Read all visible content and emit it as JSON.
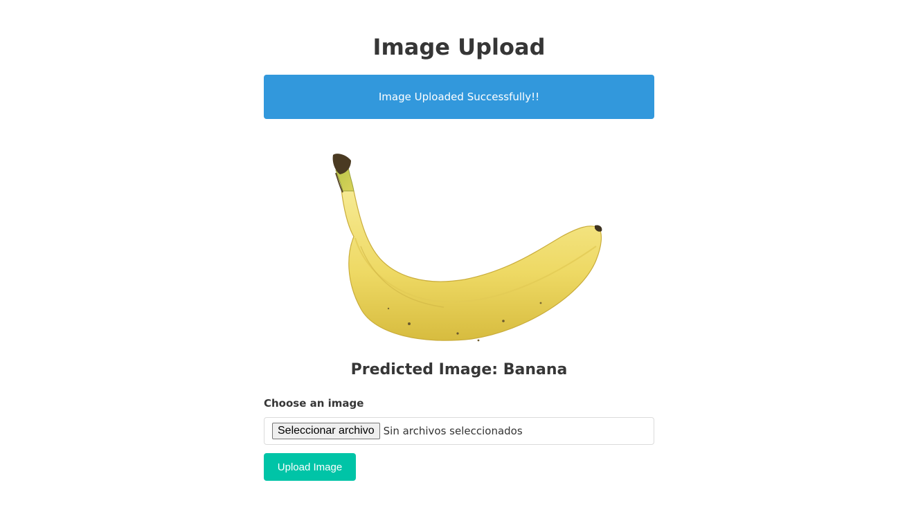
{
  "header": {
    "title": "Image Upload"
  },
  "alert": {
    "message": "Image Uploaded Successfully!!",
    "color": "#3298dc"
  },
  "preview": {
    "subject": "banana"
  },
  "prediction": {
    "text": "Predicted Image: Banana"
  },
  "form": {
    "label": "Choose an image",
    "file_button_label": "Seleccionar archivo",
    "file_status": "Sin archivos seleccionados",
    "submit_label": "Upload Image",
    "submit_color": "#00c4a7"
  }
}
